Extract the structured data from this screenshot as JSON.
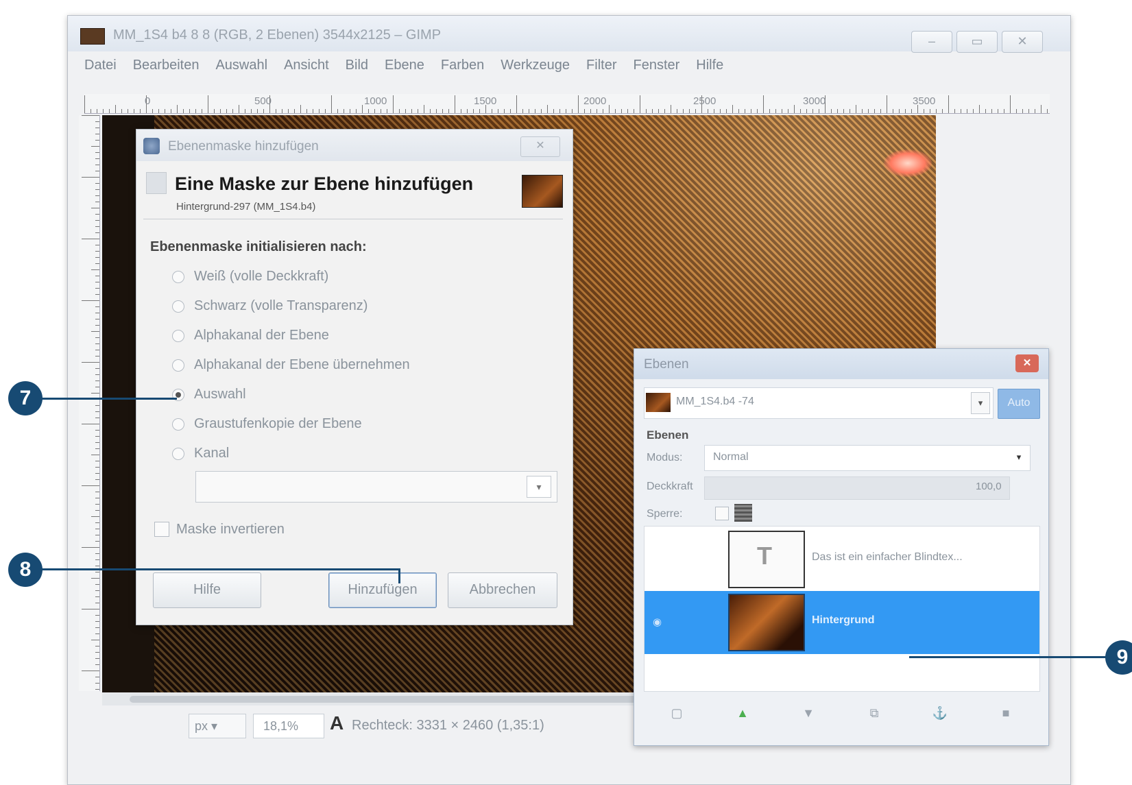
{
  "window": {
    "title": "MM_1S4 b4 8 8 (RGB, 2 Ebenen) 3544x2125 – GIMP",
    "menu": [
      "Datei",
      "Bearbeiten",
      "Auswahl",
      "Ansicht",
      "Bild",
      "Ebene",
      "Farben",
      "Werkzeuge",
      "Filter",
      "Fenster",
      "Hilfe"
    ],
    "ruler_labels": [
      "0",
      "500",
      "1000",
      "1500",
      "2000",
      "2500",
      "3000",
      "3500"
    ],
    "status": {
      "unit": "px ▾",
      "zoom": "18,1%",
      "tool_text": "Rechteck: 3331 × 2460 (1,35:1)"
    }
  },
  "dialog": {
    "title": "Ebenenmaske hinzufügen",
    "heading": "Eine Maske zur Ebene hinzufügen",
    "subheading": "Hintergrund-297 (MM_1S4.b4)",
    "section_label": "Ebenenmaske initialisieren nach:",
    "options": [
      "Weiß (volle Deckkraft)",
      "Schwarz (volle Transparenz)",
      "Alphakanal der Ebene",
      "Alphakanal der Ebene übernehmen",
      "Auswahl",
      "Graustufenkopie der Ebene",
      "Kanal"
    ],
    "selected_option": 4,
    "invert_label": "Maske invertieren",
    "buttons": {
      "help": "Hilfe",
      "add": "Hinzufügen",
      "cancel": "Abbrechen"
    }
  },
  "layers_panel": {
    "title": "Ebenen",
    "image_name": "MM_1S4.b4 -74",
    "auto_label": "Auto",
    "section_label": "Ebenen",
    "mode_label": "Modus:",
    "mode_value": "Normal",
    "opacity_label": "Deckkraft",
    "opacity_value": "100,0",
    "opacity_fraction": 1.0,
    "lock_label": "Sperre:",
    "layers": [
      {
        "name": "Das ist ein einfacher Blindtex..."
      },
      {
        "name": "Hintergrund"
      }
    ],
    "selected_layer": 1
  },
  "callouts": [
    "7",
    "8",
    "9"
  ],
  "colors": {
    "callout": "#174a73",
    "selection": "#3399f3"
  }
}
